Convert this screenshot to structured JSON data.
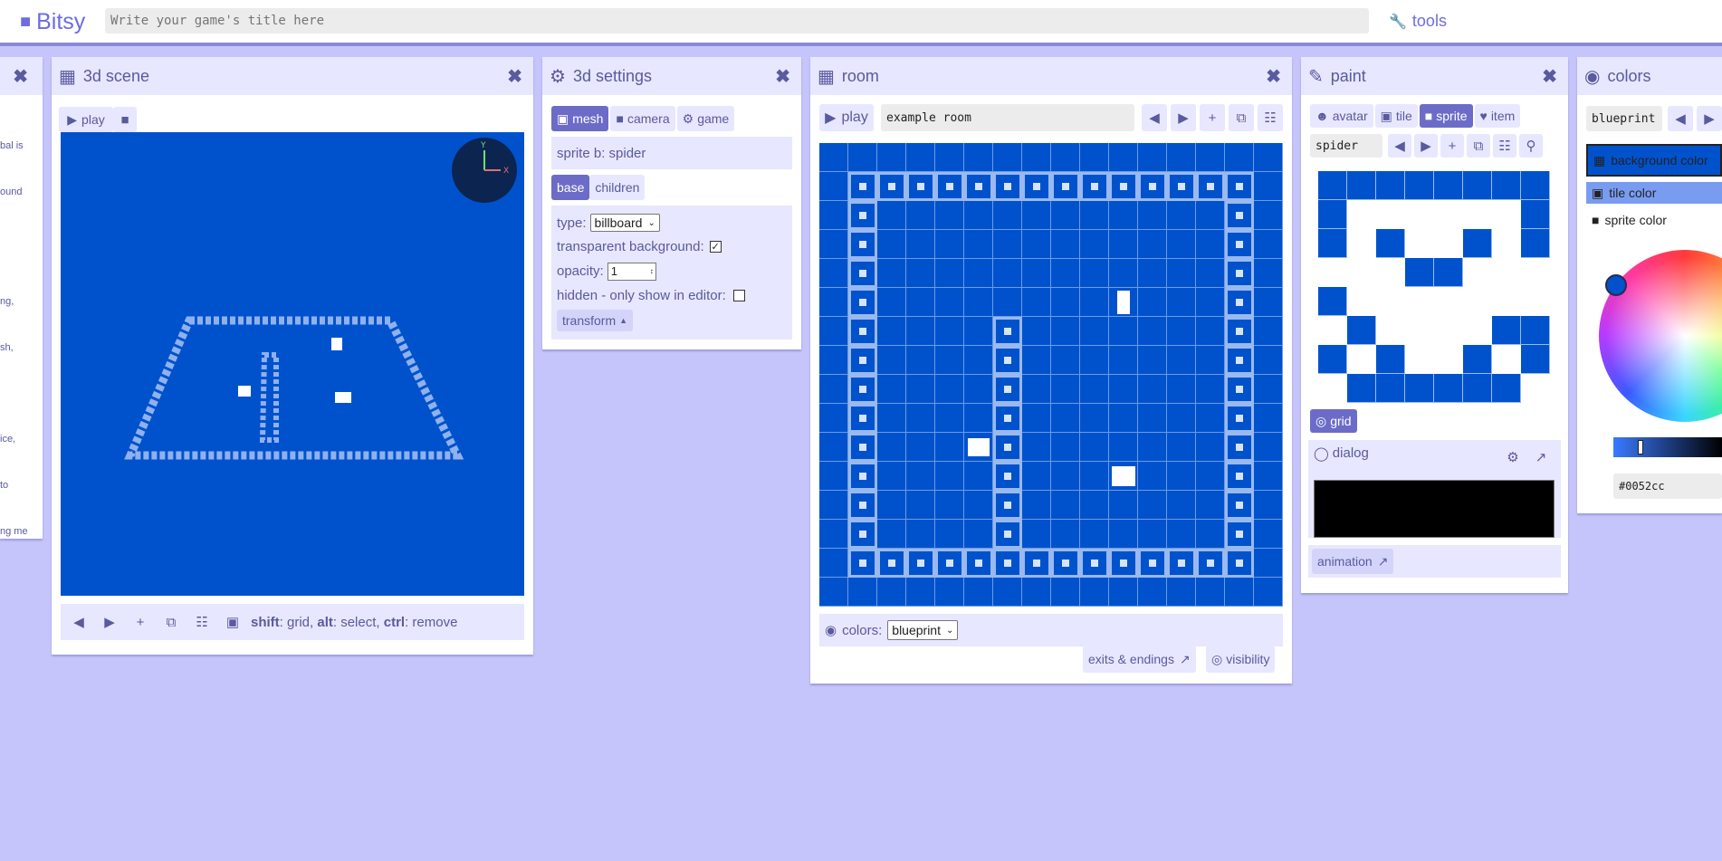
{
  "app": {
    "name": "Bitsy",
    "title_placeholder": "Write your game's title here",
    "tools_label": "tools"
  },
  "colors_accent": {
    "bg": "#c6c5fb",
    "panel_head": "#e7e7ff",
    "accent": "#6c6cc8",
    "room_bg": "#0052cc"
  },
  "left_panel": {
    "text_lines": [
      "bal is",
      "ound",
      "ng,",
      "sh,",
      "ice,",
      "to",
      "ng me"
    ]
  },
  "scene3d": {
    "title": "3d scene",
    "play_label": "play",
    "footer_hint": [
      {
        "key": "shift",
        "desc": ": grid, "
      },
      {
        "key": "alt",
        "desc": ": select, "
      },
      {
        "key": "ctrl",
        "desc": ": remove"
      }
    ]
  },
  "settings3d": {
    "title": "3d settings",
    "tabs": [
      "mesh",
      "camera",
      "game"
    ],
    "selected_item": "sprite b: spider",
    "subtabs": [
      "base",
      "children"
    ],
    "type_label": "type:",
    "type_value": "billboard",
    "transparent_label": "transparent background:",
    "transparent_checked": true,
    "opacity_label": "opacity:",
    "opacity_value": "1",
    "hidden_label": "hidden - only show in editor:",
    "hidden_checked": false,
    "transform_label": "transform"
  },
  "room": {
    "title": "room",
    "play_label": "play",
    "room_name": "example room",
    "colors_label": "colors:",
    "palette": "blueprint",
    "exits_label": "exits & endings",
    "visibility_label": "visibility"
  },
  "paint": {
    "title": "paint",
    "tabs": [
      "avatar",
      "tile",
      "sprite",
      "item"
    ],
    "selected_tab": "sprite",
    "drawing_name": "spider",
    "grid_label": "grid",
    "dialog_label": "dialog",
    "animation_label": "animation"
  },
  "colors": {
    "title": "colors",
    "palette_name": "blueprint",
    "options": [
      "background color",
      "tile color",
      "sprite color"
    ],
    "hex_value": "#0052cc"
  }
}
